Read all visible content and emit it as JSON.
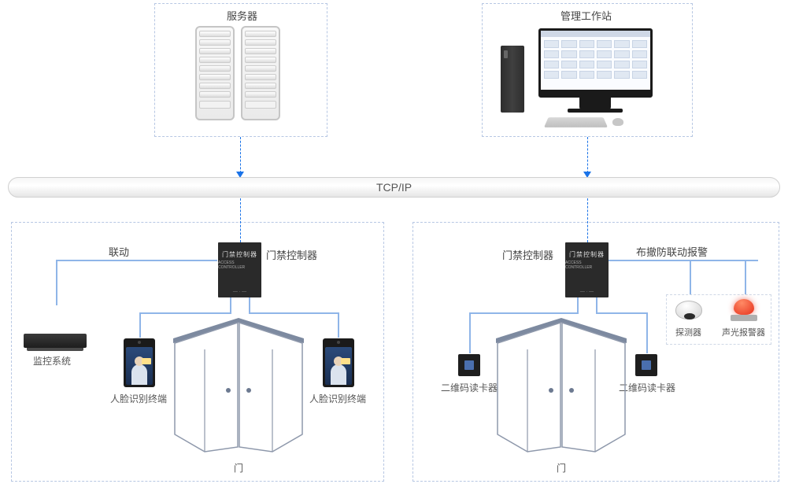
{
  "top": {
    "server_label": "服务器",
    "workstation_label": "管理工作站"
  },
  "bus_label": "TCP/IP",
  "left": {
    "linkage_label": "联动",
    "controller_label": "门禁控制器",
    "controller_title": "门禁控制器",
    "controller_sub": "ACCESS CONTROLLER",
    "surveillance_label": "监控系统",
    "face_terminal_label_left": "人脸识别终端",
    "face_terminal_label_right": "人脸识别终端",
    "door_label": "门"
  },
  "right": {
    "controller_label": "门禁控制器",
    "alarm_linkage_label": "布撤防联动报警",
    "controller_title": "门禁控制器",
    "controller_sub": "ACCESS CONTROLLER",
    "qr_label_left": "二维码读卡器",
    "qr_label_right": "二维码读卡器",
    "detector_label": "探测器",
    "siren_label": "声光报警器",
    "door_label": "门"
  }
}
